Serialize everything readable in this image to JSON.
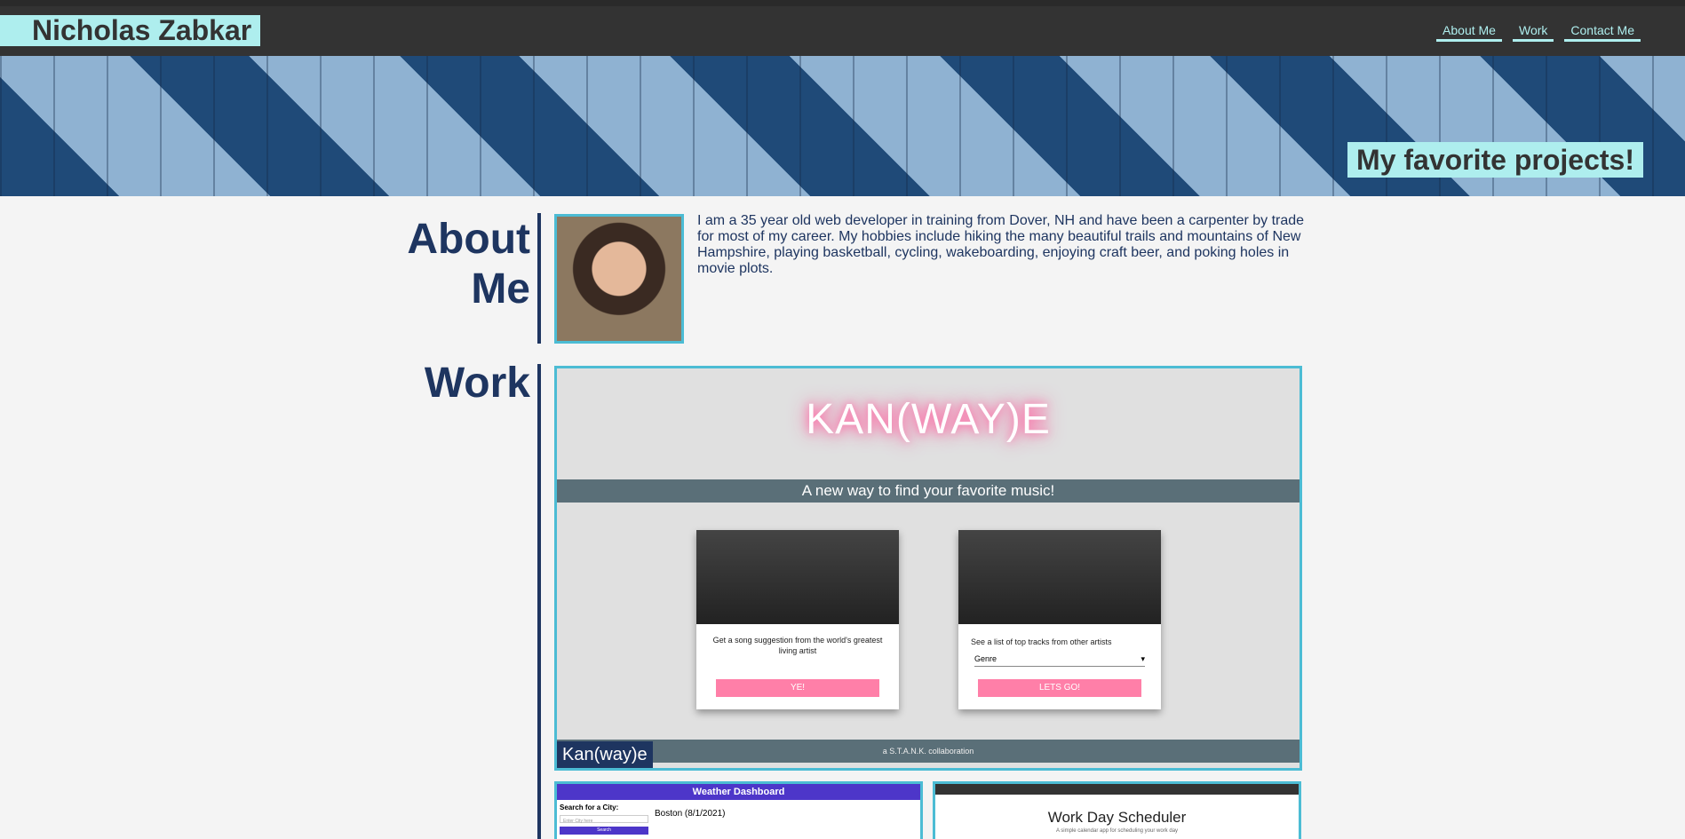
{
  "header": {
    "brand": "Nicholas Zabkar",
    "nav": [
      "About Me",
      "Work",
      "Contact Me"
    ]
  },
  "hero": {
    "tagline": "My favorite projects!"
  },
  "about": {
    "title": "About Me",
    "bio": "I am a 35 year old web developer in training from Dover, NH and have been a carpenter by trade for most of my career. My hobbies include hiking the many beautiful trails and mountains of New Hampshire, playing basketball, cycling, wakeboarding, enjoying craft beer, and poking holes in movie plots."
  },
  "work": {
    "title": "Work",
    "featured": {
      "label": "Kan(way)e",
      "logo": "KAN(WAY)E",
      "banner": "A new way to find your favorite music!",
      "card1_text": "Get a song suggestion from the world's greatest living artist",
      "card1_button": "YE!",
      "card2_text": "See a list of top tracks from other artists",
      "card2_select": "Genre",
      "card2_button": "LETS GO!",
      "footer": "a S.T.A.N.K. collaboration"
    },
    "weather": {
      "title": "Weather Dashboard",
      "search_label": "Search for a City:",
      "input_placeholder": "Enter City here",
      "search_button": "Search",
      "city": "Boston (8/1/2021)"
    },
    "scheduler": {
      "title": "Work Day Scheduler",
      "subtitle": "A simple calendar app for scheduling your work day"
    }
  }
}
